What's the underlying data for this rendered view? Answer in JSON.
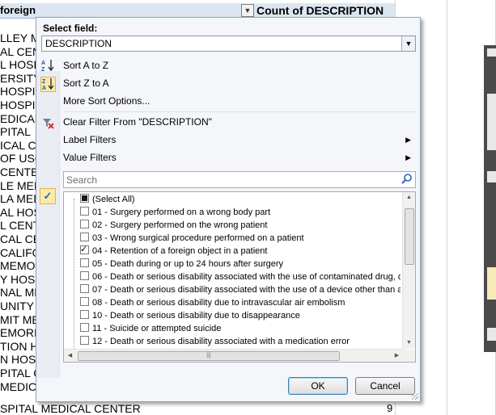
{
  "sheet": {
    "header_left": "foreign",
    "header_right": "Count of DESCRIPTION",
    "row_labels": [
      "LLEY M",
      "AL CENT",
      "L HOSP",
      "ERSITY",
      "HOSPIT",
      "HOSPI",
      "EDICAL",
      "PITAL",
      "ICAL C",
      "OF USC",
      "CENTE",
      "LE MED",
      "LA MEDI",
      "AL HOS",
      "L CENT",
      "CAL CEN",
      "CALIFOR",
      "MEMOR",
      "Y HOS",
      "NAL ME",
      "UNITY",
      "MIT ME",
      "EMORI",
      "TION HO",
      "N HOSP",
      "PITAL C",
      "MEDICA"
    ],
    "last_row_label": "SPITAL MEDICAL CENTER",
    "last_row_value": "9"
  },
  "panel": {
    "select_label": "Select field:",
    "select_value": "DESCRIPTION",
    "menu": {
      "sort_az": "Sort A to Z",
      "sort_za": "Sort Z to A",
      "more_sort": "More Sort Options...",
      "clear_filter": "Clear Filter From \"DESCRIPTION\"",
      "label_filters": "Label Filters",
      "value_filters": "Value Filters"
    },
    "search_placeholder": "Search",
    "items": [
      {
        "label": "(Select All)",
        "state": "partial"
      },
      {
        "label": "01 - Surgery performed on a wrong body part",
        "state": "off"
      },
      {
        "label": "02 - Surgery performed on the wrong patient",
        "state": "off"
      },
      {
        "label": "03 - Wrong surgical procedure performed on a patient",
        "state": "off"
      },
      {
        "label": "04 - Retention of a foreign object in a patient",
        "state": "on"
      },
      {
        "label": "05 - Death during or up to 24 hours after surgery",
        "state": "off"
      },
      {
        "label": "06 - Death or serious disability associated with the use of contaminated drug, d",
        "state": "off"
      },
      {
        "label": "07 - Death or serious disability associated with the use of a device other than a",
        "state": "off"
      },
      {
        "label": "08 - Death or serious disability due to intravascular air embolism",
        "state": "off"
      },
      {
        "label": "10 - Death or serious disability due to disappearance",
        "state": "off"
      },
      {
        "label": "11 - Suicide or attempted suicide",
        "state": "off"
      },
      {
        "label": "12 - Death or serious disability associated with a medication error",
        "state": "off"
      }
    ],
    "ok_label": "OK",
    "cancel_label": "Cancel"
  }
}
